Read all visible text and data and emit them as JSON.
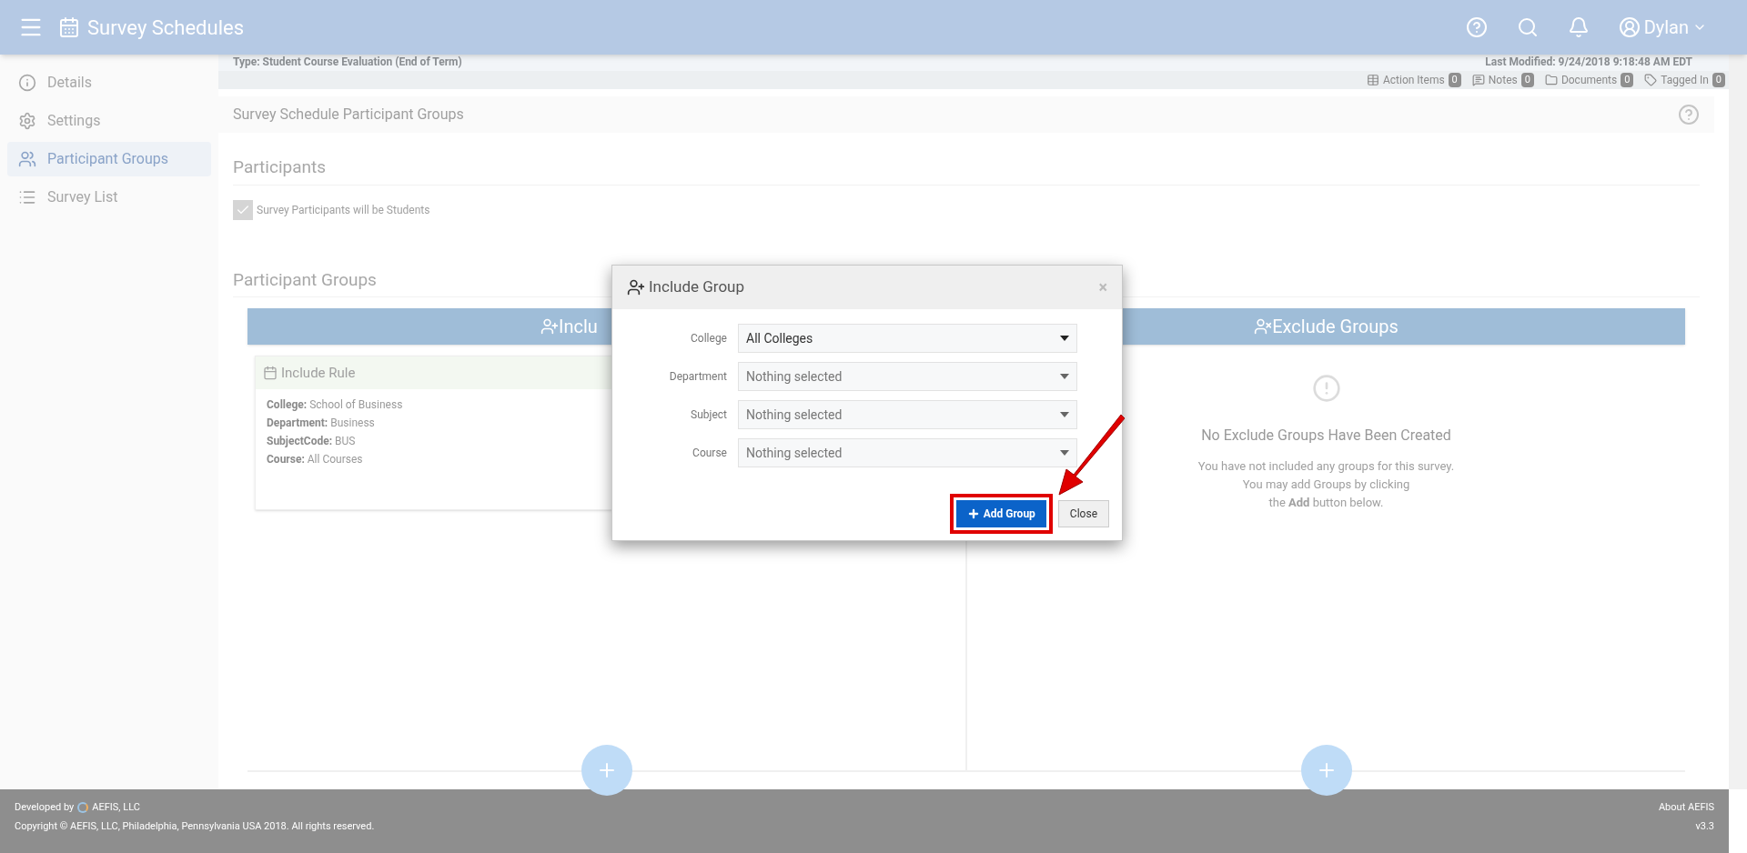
{
  "header": {
    "title": "Survey Schedules",
    "user": "Dylan"
  },
  "sidebar": {
    "items": [
      {
        "label": "Details",
        "selected": false
      },
      {
        "label": "Settings",
        "selected": false
      },
      {
        "label": "Participant Groups",
        "selected": true
      },
      {
        "label": "Survey List",
        "selected": false
      }
    ]
  },
  "info_strip": {
    "type": "Type: Student Course Evaluation (End of Term)",
    "last_modified": "Last Modified: 9/24/2018 9:18:48 AM EDT"
  },
  "counters": [
    {
      "label": "Action Items",
      "count": "0"
    },
    {
      "label": "Notes",
      "count": "0"
    },
    {
      "label": "Documents",
      "count": "0"
    },
    {
      "label": "Tagged In",
      "count": "0"
    }
  ],
  "section_title": "Survey Schedule Participant Groups",
  "participants": {
    "heading": "Participants",
    "checkbox": {
      "label": "Survey Participants will be Students",
      "checked": true
    }
  },
  "groups": {
    "heading": "Participant Groups",
    "include": {
      "title": "Inclu",
      "rule": {
        "title": "Include Rule",
        "fields": [
          {
            "label": "College:",
            "value": "School of Business"
          },
          {
            "label": "Department:",
            "value": "Business"
          },
          {
            "label": "SubjectCode:",
            "value": "BUS"
          },
          {
            "label": "Course:",
            "value": "All Courses"
          }
        ]
      }
    },
    "exclude": {
      "title": "Exclude Groups",
      "empty_title": "No Exclude Groups Have Been Created",
      "empty_lines": [
        "You have not included any groups for this survey.",
        "You may add Groups by clicking",
        "the **Add** button below."
      ]
    }
  },
  "dialog": {
    "title": "Include Group",
    "close_glyph": "×",
    "fields": [
      {
        "label": "College",
        "value": "All Colleges",
        "placeholder": false
      },
      {
        "label": "Department",
        "value": "Nothing selected",
        "placeholder": true
      },
      {
        "label": "Subject",
        "value": "Nothing selected",
        "placeholder": true
      },
      {
        "label": "Course",
        "value": "Nothing selected",
        "placeholder": true
      }
    ],
    "buttons": [
      {
        "label": "Add Group",
        "kind": "primary"
      },
      {
        "label": "Close",
        "kind": "default"
      }
    ]
  },
  "footer": {
    "developed_by": "Developed by",
    "company": "AEFIS, LLC",
    "copyright": "Copyright © AEFIS, LLC, Philadelphia, Pennsylvania USA 2018. All rights reserved.",
    "about": "About AEFIS",
    "version": "v3.3"
  }
}
